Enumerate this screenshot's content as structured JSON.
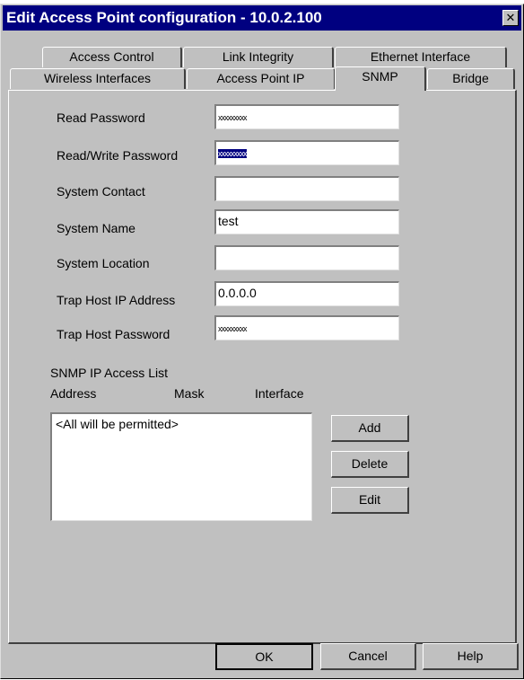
{
  "window": {
    "title": "Edit Access Point configuration - 10.0.2.100"
  },
  "tabs": {
    "row_back": [
      "Access Control",
      "Link Integrity",
      "Ethernet Interface"
    ],
    "row_front": [
      "Wireless Interfaces",
      "Access Point IP",
      "SNMP",
      "Bridge"
    ],
    "active": "SNMP"
  },
  "form": {
    "read_password": {
      "label": "Read Password",
      "value": "xxxxxxxxx"
    },
    "rw_password": {
      "label": "Read/Write Password",
      "value": "xxxxxxxxx"
    },
    "system_contact": {
      "label": "System Contact",
      "value": ""
    },
    "system_name": {
      "label": "System Name",
      "value": "test"
    },
    "system_location": {
      "label": "System Location",
      "value": ""
    },
    "trap_host_ip": {
      "label": "Trap Host IP Address",
      "value": "0.0.0.0"
    },
    "trap_host_password": {
      "label": "Trap Host Password",
      "value": "xxxxxxxxx"
    }
  },
  "access_list": {
    "title": "SNMP IP Access List",
    "columns": [
      "Address",
      "Mask",
      "Interface"
    ],
    "items": [
      "<All will be permitted>"
    ],
    "buttons": {
      "add": "Add",
      "delete": "Delete",
      "edit": "Edit"
    }
  },
  "footer": {
    "ok": "OK",
    "cancel": "Cancel",
    "help": "Help"
  }
}
